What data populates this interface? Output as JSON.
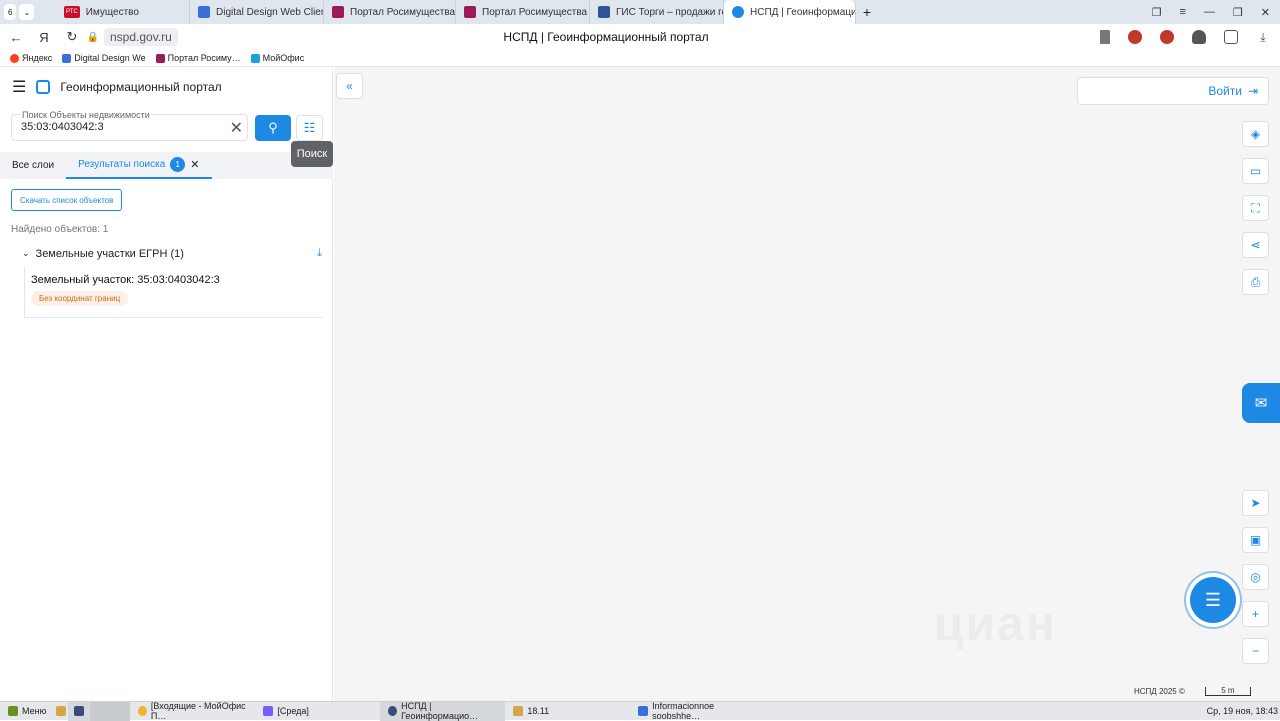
{
  "browser": {
    "tab_count": "6",
    "tabs": [
      {
        "label": "Имущество",
        "color": "#c8102e",
        "brand": "РТС"
      },
      {
        "label": "Digital Design Web Client",
        "color": "#3b6fd8"
      },
      {
        "label": "Портал Росимущества",
        "color": "#9b1b5a"
      },
      {
        "label": "Портал Росимущества",
        "color": "#9b1b5a"
      },
      {
        "label": "ГИС Торги – продажи гос",
        "color": "#2f5597"
      },
      {
        "label": "НСПД | Геоинформаци",
        "color": "#1e88e5",
        "active": true
      }
    ],
    "url": "nspd.gov.ru",
    "page_title": "НСПД | Геоинформационный портал",
    "bookmarks": [
      {
        "label": "Яндекс",
        "color": "#fc3f1d"
      },
      {
        "label": "Digital Design We",
        "color": "#3b6fd8"
      },
      {
        "label": "Портал Росиму…",
        "color": "#9b1b5a"
      },
      {
        "label": "МойОфис",
        "color": "#1aa3d9"
      }
    ]
  },
  "sidebar": {
    "title": "Геоинформационный портал",
    "search": {
      "label": "Поиск Объекты недвижимости",
      "value": "35:03:0403042:3"
    },
    "tooltip": "Поиск",
    "tabs": [
      {
        "label": "Все слои"
      },
      {
        "label": "Результаты поиска",
        "count": "1"
      }
    ],
    "download_list_label": "Скачать список объектов",
    "found_label": "Найдено объектов: 1",
    "group_label": "Земельные участки ЕГРН (1)",
    "item": {
      "title": "Земельный участок: 35:03:0403042:3",
      "badge": "Без координат границ"
    }
  },
  "map": {
    "login_label": "Войти",
    "watermark": "циан",
    "copyright": "НСПД 2025 ©",
    "scale": "5 m"
  },
  "taskbar": {
    "start_label": "Меню",
    "tasks": [
      {
        "label": "[Входящие - МойОфис П…",
        "color": "#f2b233"
      },
      {
        "label": "[Среда]",
        "color": "#7a5cff"
      },
      {
        "label": "НСПД | Геоинформацио…",
        "color": "#3b4a78",
        "active": true
      },
      {
        "label": "18.11",
        "color": "#d7a44a"
      },
      {
        "label": "Informacionnoe soobshhe…",
        "color": "#3b6fd8"
      }
    ],
    "clock": "Ср, 19 ноя, 18:43"
  },
  "colors": {
    "accent": "#1e88e5",
    "badge_text": "#d46a17",
    "badge_bg": "#fdf0e6"
  }
}
